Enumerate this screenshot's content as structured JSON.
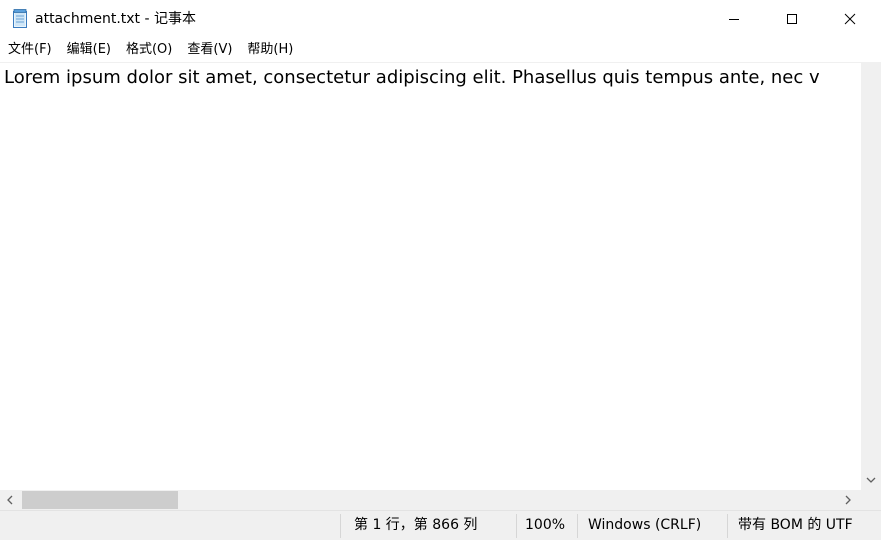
{
  "window": {
    "title": "attachment.txt - 记事本"
  },
  "menu": {
    "items": [
      {
        "label": "文件(F)"
      },
      {
        "label": "编辑(E)"
      },
      {
        "label": "格式(O)"
      },
      {
        "label": "查看(V)"
      },
      {
        "label": "帮助(H)"
      }
    ]
  },
  "editor": {
    "text": "Lorem ipsum dolor sit amet, consectetur adipiscing elit. Phasellus quis tempus ante, nec v"
  },
  "status": {
    "position": "第 1 行，第 866 列",
    "zoom": "100%",
    "line_ending": "Windows (CRLF)",
    "encoding": "带有 BOM 的 UTF"
  },
  "icons": {
    "app": "notepad-icon",
    "minimize": "minimize-icon",
    "maximize": "maximize-icon",
    "close": "close-icon"
  }
}
